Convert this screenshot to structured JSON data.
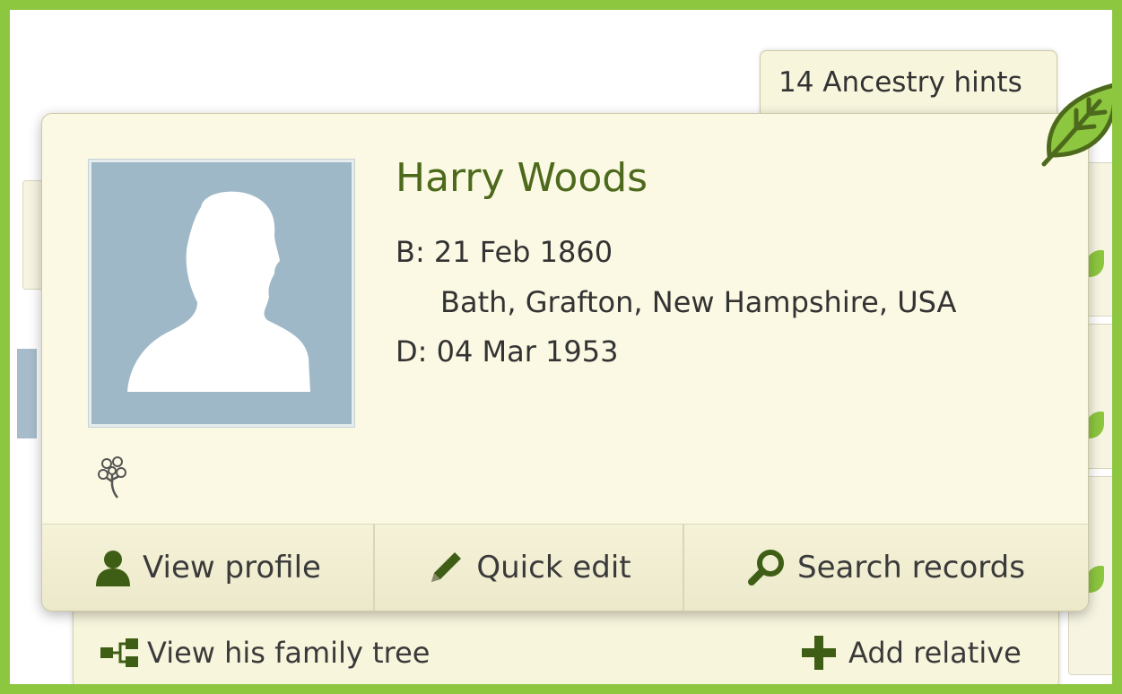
{
  "hints_tab": {
    "label": "14 Ancestry hints"
  },
  "person": {
    "name": "Harry Woods",
    "birth_label": "B: 21 Feb 1860",
    "birth_place": "Bath, Grafton, New Hampshire, USA",
    "death_label": "D: 04 Mar 1953"
  },
  "actions": {
    "view_profile": "View profile",
    "quick_edit": "Quick edit",
    "search_records": "Search records"
  },
  "bottom_bar": {
    "family_tree": "View his family tree",
    "add_relative": "Add relative"
  },
  "icons": {
    "leaf": "leaf-icon",
    "profile": "person-icon",
    "edit": "pencil-icon",
    "search": "magnifier-icon",
    "tree": "tree-icon",
    "add": "plus-icon",
    "family_tree": "family-tree-icon"
  },
  "colors": {
    "border_green": "#8dc63f",
    "name_green": "#4d6a1c",
    "icon_green": "#3f5e15",
    "card_bg": "#fbf9e3",
    "photo_bg": "#9fb8c8"
  }
}
